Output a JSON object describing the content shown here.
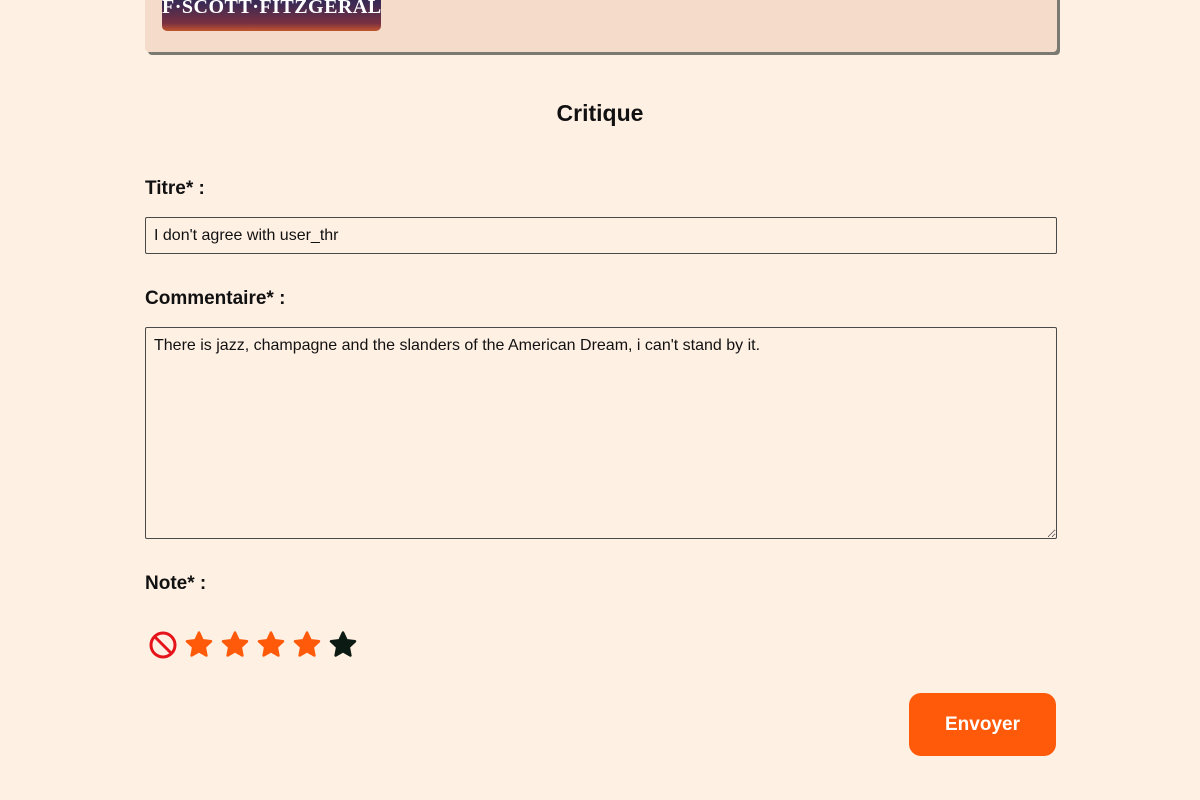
{
  "book": {
    "cover_text": "F·SCOTT·FITZGERALD"
  },
  "form": {
    "heading": "Critique",
    "title_label": "Titre* :",
    "title_value": "I don't agree with user_thr",
    "comment_label": "Commentaire* :",
    "comment_value": "There is jazz, champagne and the slanders of the American Dream, i can't stand by it.",
    "rating_label": "Note* :",
    "rating": {
      "max": 5,
      "value": 4,
      "clear_icon": "no-rating-icon",
      "star_icon": "star-icon"
    },
    "submit_label": "Envoyer"
  },
  "colors": {
    "background": "#fff0e4",
    "card": "#f5dcca",
    "accent": "#ff5a0a",
    "star_filled": "#ff5a0a",
    "star_empty": "#0c1a14",
    "clear_icon": "#e5141b"
  }
}
